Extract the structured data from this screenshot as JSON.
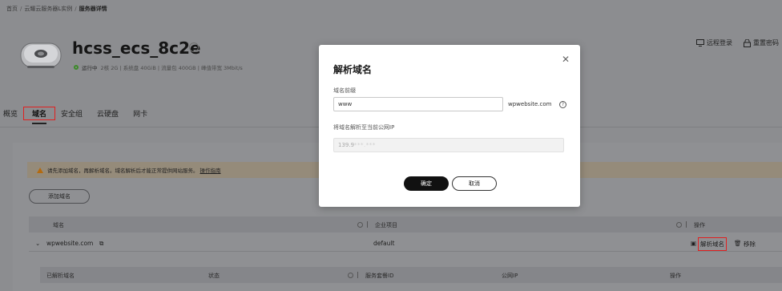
{
  "breadcrumb": {
    "home": "首页",
    "instances": "云耀云服务器L实例",
    "current": "服务器详情"
  },
  "server": {
    "name": "hcss_ecs_8c2e",
    "status": "运行中",
    "specs": "2核 2G | 系统盘 40GiB | 流量包 400GB | 峰值带宽 3Mbit/s"
  },
  "actions": {
    "remote_login": "远程登录",
    "reset_password": "重置密码"
  },
  "tabs": [
    {
      "label": "概览"
    },
    {
      "label": "域名"
    },
    {
      "label": "安全组"
    },
    {
      "label": "云硬盘"
    },
    {
      "label": "网卡"
    }
  ],
  "notice": {
    "text": "请先添加域名，再解析域名。域名解析后才能正常提供网站服务。",
    "link": "操作指南"
  },
  "add_domain_button": "添加域名",
  "table": {
    "headers": {
      "domain": "域名",
      "project": "企业项目",
      "actions": "操作"
    },
    "rows": [
      {
        "domain": "wpwebsite.com",
        "project": "default",
        "parse": "解析域名",
        "remove": "移除"
      }
    ]
  },
  "subtable": {
    "headers": {
      "parsed": "已解析域名",
      "status": "状态",
      "package_id": "服务套餐ID",
      "public_ip": "公网IP",
      "actions": "操作"
    }
  },
  "modal": {
    "title": "解析域名",
    "prefix_label": "域名前缀",
    "prefix_value": "www",
    "suffix": "wpwebsite.com",
    "ip_label": "将域名解析至当前公网IP",
    "ip_value": "139.9",
    "ip_masked": "***.***",
    "confirm": "确定",
    "cancel": "取消"
  }
}
